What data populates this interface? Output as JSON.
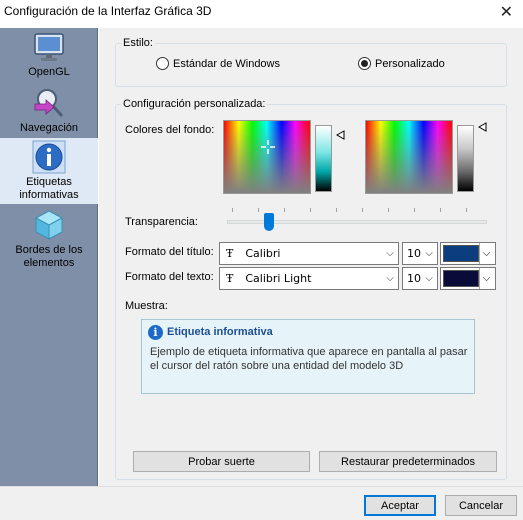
{
  "window": {
    "title": "Configuración de la Interfaz Gráfica 3D",
    "close_glyph": "✕"
  },
  "sidebar": {
    "items": [
      {
        "label": "OpenGL",
        "icon": "monitor-icon"
      },
      {
        "label": "Navegación",
        "icon": "navigation-icon"
      },
      {
        "label": "Etiquetas\ninformativas",
        "icon": "info-icon",
        "active": true
      },
      {
        "label": "Bordes de los\nelementos",
        "icon": "cube-icon"
      }
    ]
  },
  "style_group": {
    "legend": "Estilo:",
    "options": [
      {
        "label": "Estándar de Windows",
        "selected": false
      },
      {
        "label": "Personalizado",
        "selected": true
      }
    ]
  },
  "custom_group": {
    "legend": "Configuración personalizada:",
    "background_label": "Colores del fondo:",
    "transparency_label": "Transparencia:",
    "transparency_value": 0.16,
    "title_format_label": "Formato del título:",
    "title_font": "Calibri",
    "title_size": "10",
    "title_color": "#0c3d7e",
    "text_format_label": "Formato del texto:",
    "text_font": "Calibri Light",
    "text_size": "10",
    "text_color": "#0b0b3a",
    "font_glyph": "Ŧ",
    "sample_label": "Muestra:",
    "sample_title": "Etiqueta informativa",
    "sample_text": "Ejemplo de etiqueta informativa que aparece en pantalla al pasar el cursor del ratón sobre una entidad del modelo 3D",
    "info_glyph": "i",
    "luck_button": "Probar suerte",
    "reset_button": "Restaurar predeterminados"
  },
  "footer": {
    "ok": "Aceptar",
    "cancel": "Cancelar"
  },
  "colors": {
    "sidebar_bg": "#7f8fa7",
    "accent": "#0078d7",
    "preview_bg": "#e6f3f8"
  }
}
